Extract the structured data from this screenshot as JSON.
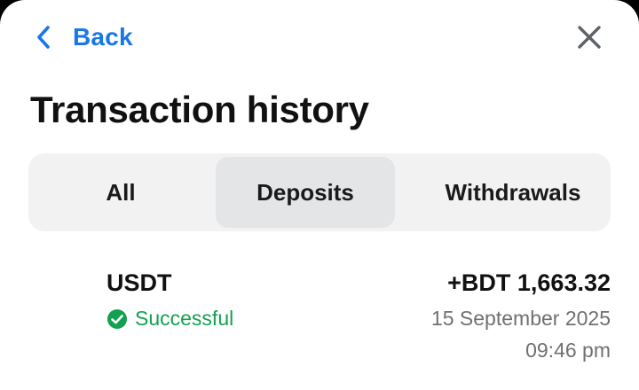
{
  "nav": {
    "back_label": "Back",
    "back_icon": "chevron-left-icon",
    "close_icon": "close-icon"
  },
  "title": "Transaction history",
  "tabs": [
    {
      "label": "All",
      "selected": false
    },
    {
      "label": "Deposits",
      "selected": true
    },
    {
      "label": "Withdrawals",
      "selected": false
    }
  ],
  "transactions": [
    {
      "currency": "USDT",
      "status": "Successful",
      "status_icon": "check-circle-icon",
      "amount": "+BDT 1,663.32",
      "date": "15 September 2025",
      "time": "09:46 pm"
    }
  ],
  "colors": {
    "accent": "#1877e8",
    "success": "#12a150",
    "selected_tab_bg": "#e4e5e7",
    "tab_bar_bg": "#f2f2f3",
    "muted_text": "#707070"
  }
}
